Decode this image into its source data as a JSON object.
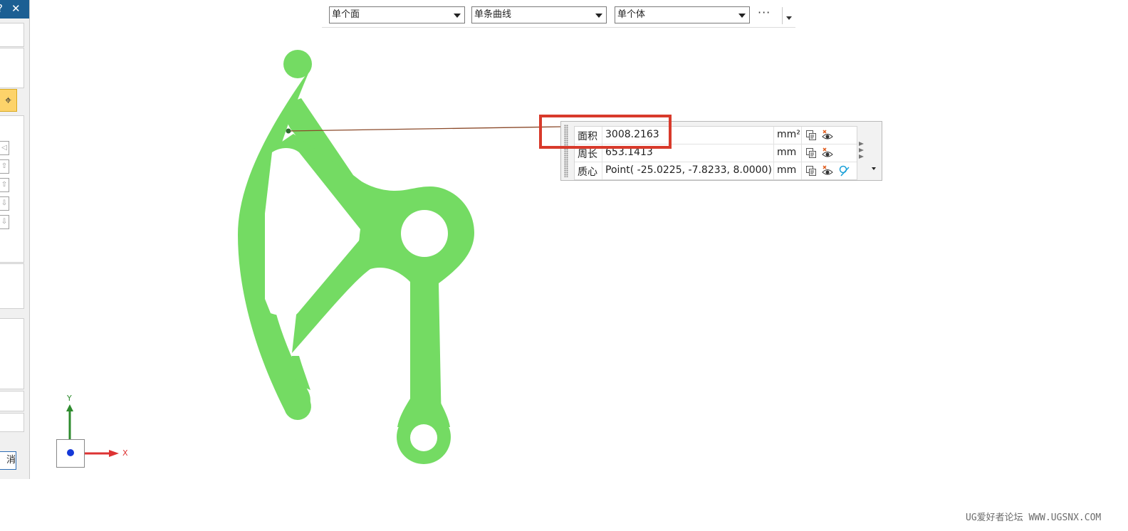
{
  "dialog": {
    "title_buttons": {
      "help": "?",
      "close": "✕"
    },
    "snap_icon": "⌖",
    "mini_icons": [
      "◁",
      "⇧",
      "⇧",
      "⇩",
      "⇩"
    ],
    "cancel_label": "消"
  },
  "selection_bar": {
    "face_rule": "单个面",
    "curve_rule": "单条曲线",
    "body_rule": "单个体",
    "more": "···"
  },
  "measurement": {
    "rows": [
      {
        "name": "面积",
        "value": "3008.2163",
        "unit": "mm²",
        "icons": [
          "copy-to-clipboard-icon",
          "show-hide-icon"
        ]
      },
      {
        "name": "周长",
        "value": "653.1413",
        "unit": "mm",
        "icons": [
          "copy-to-clipboard-icon",
          "show-hide-icon"
        ]
      },
      {
        "name": "质心",
        "value": "Point( -25.0225, -7.8233, 8.0000)",
        "unit": "mm",
        "icons": [
          "copy-to-clipboard-icon",
          "show-hide-icon",
          "point-icon"
        ]
      }
    ]
  },
  "triad": {
    "x_label": "X",
    "y_label": "Y"
  },
  "colors": {
    "part_face": "#74db63",
    "highlight": "#d83a2b",
    "leader_line": "#8b4a2a",
    "titlebar": "#1c5f93"
  },
  "watermark": "UG爱好者论坛 WWW.UGSNX.COM"
}
